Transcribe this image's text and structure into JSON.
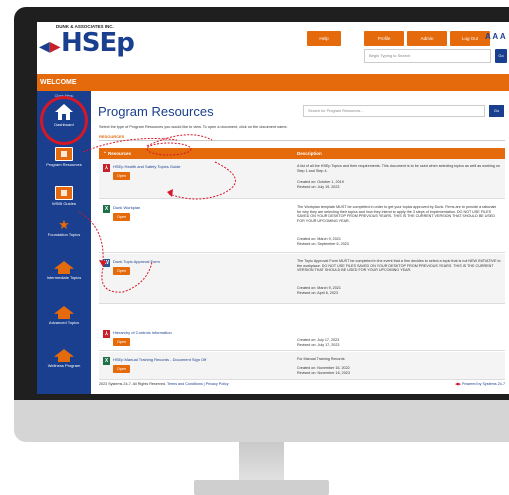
{
  "header": {
    "company": "DUNK & ASSOCIATES INC.",
    "logo": "HSEp",
    "buttons": [
      "Help",
      "Profile",
      "Admin",
      "Log Out"
    ],
    "font_size_controls": "A A A",
    "search_placeholder": "Begin Typing to Search",
    "search_button": "Go"
  },
  "banner": {
    "title": "WELCOME"
  },
  "sidebar": {
    "close_label": "Close Menu",
    "items": [
      {
        "label": "Dashboard",
        "icon": "home-icon"
      },
      {
        "label": "Program Resources",
        "icon": "resources-icon"
      },
      {
        "label": "WSIB Guides",
        "icon": "guides-icon"
      },
      {
        "label": "Foundation Topics",
        "icon": "star-icon"
      },
      {
        "label": "Intermediate Topics",
        "icon": "house-icon"
      },
      {
        "label": "Advanced Topics",
        "icon": "house-icon"
      },
      {
        "label": "Wellness Program",
        "icon": "wellness-icon"
      }
    ]
  },
  "main": {
    "title": "Program Resources",
    "search_placeholder": "Search for Program Resources...",
    "search_button": "Go",
    "intro": "Select the type of Program Resources you would like to view. To open a document, click on the document name.",
    "section_label": "RESOURCES",
    "table": {
      "headers": [
        "Resources",
        "Description"
      ],
      "open_label": "Open",
      "rows": [
        {
          "name": "HSEp Health and Safety Topics Guide",
          "type": "pdf",
          "description": "A list of all the HSEp Topics and their requirements. This document is to be used when selecting topics as well as working on Step 1 and Step 4.",
          "created": "Created on: October 1, 2019",
          "revised": "Revised on: July 19, 2023"
        },
        {
          "name": "Dunk Workplan",
          "type": "excel",
          "description": "The Workplan template MUST be completed in order to get your topics approved by Dunk. Firms are to provide a rationale for why they are selecting their topics and how they intend to apply the 3 steps of implementation. DO NOT USE FILES SAVED ON YOUR DESKTOP FROM PREVIOUS YEARS. THIS IS THE CURRENT VERSION THAT SHOULD BE USED FOR YOUR UPCOMING YEAR.",
          "created": "Created on: March 9, 2021",
          "revised": "Revised on: September 6, 2023"
        },
        {
          "name": "Dunk Topic Approval Form",
          "type": "word",
          "description": "The Topic Approval Form MUST be completed in the event that a firm decides to select a topic that is not NEW INITIATIVE to the workplace. DO NOT USE FILES SAVED ON YOUR DESKTOP FROM PREVIOUS YEARS. THIS IS THE CURRENT VERSION THAT SHOULD BE USED FOR YOUR UPCOMING YEAR.",
          "created": "Created on: March 9, 2021",
          "revised": "Revised on: April 6, 2023"
        },
        {
          "name": "Hierarchy of Controls Information",
          "type": "pdf",
          "description": "",
          "created": "Created on: July 17, 2023",
          "revised": "Revised on: July 17, 2023"
        },
        {
          "name": "HSEp Manual Training Records - Document Sign Off",
          "type": "excel",
          "description": "For Manual Training Records",
          "created": "Created on: November 15, 2022",
          "revised": "Revised on: November 16, 2023"
        }
      ]
    },
    "footer": {
      "copyright": "2023 Systems 24-7. All Rights Reserved.",
      "links": "Terms and Conditions | Privacy Policy",
      "powered": "Powered by Systems 24-7"
    }
  },
  "colors": {
    "brand_blue": "#1a3f8e",
    "brand_orange": "#e46a0c",
    "annotation_red": "#d4182a",
    "pdf_red": "#c7202a",
    "excel_green": "#1e7145",
    "word_blue": "#2b5797"
  }
}
